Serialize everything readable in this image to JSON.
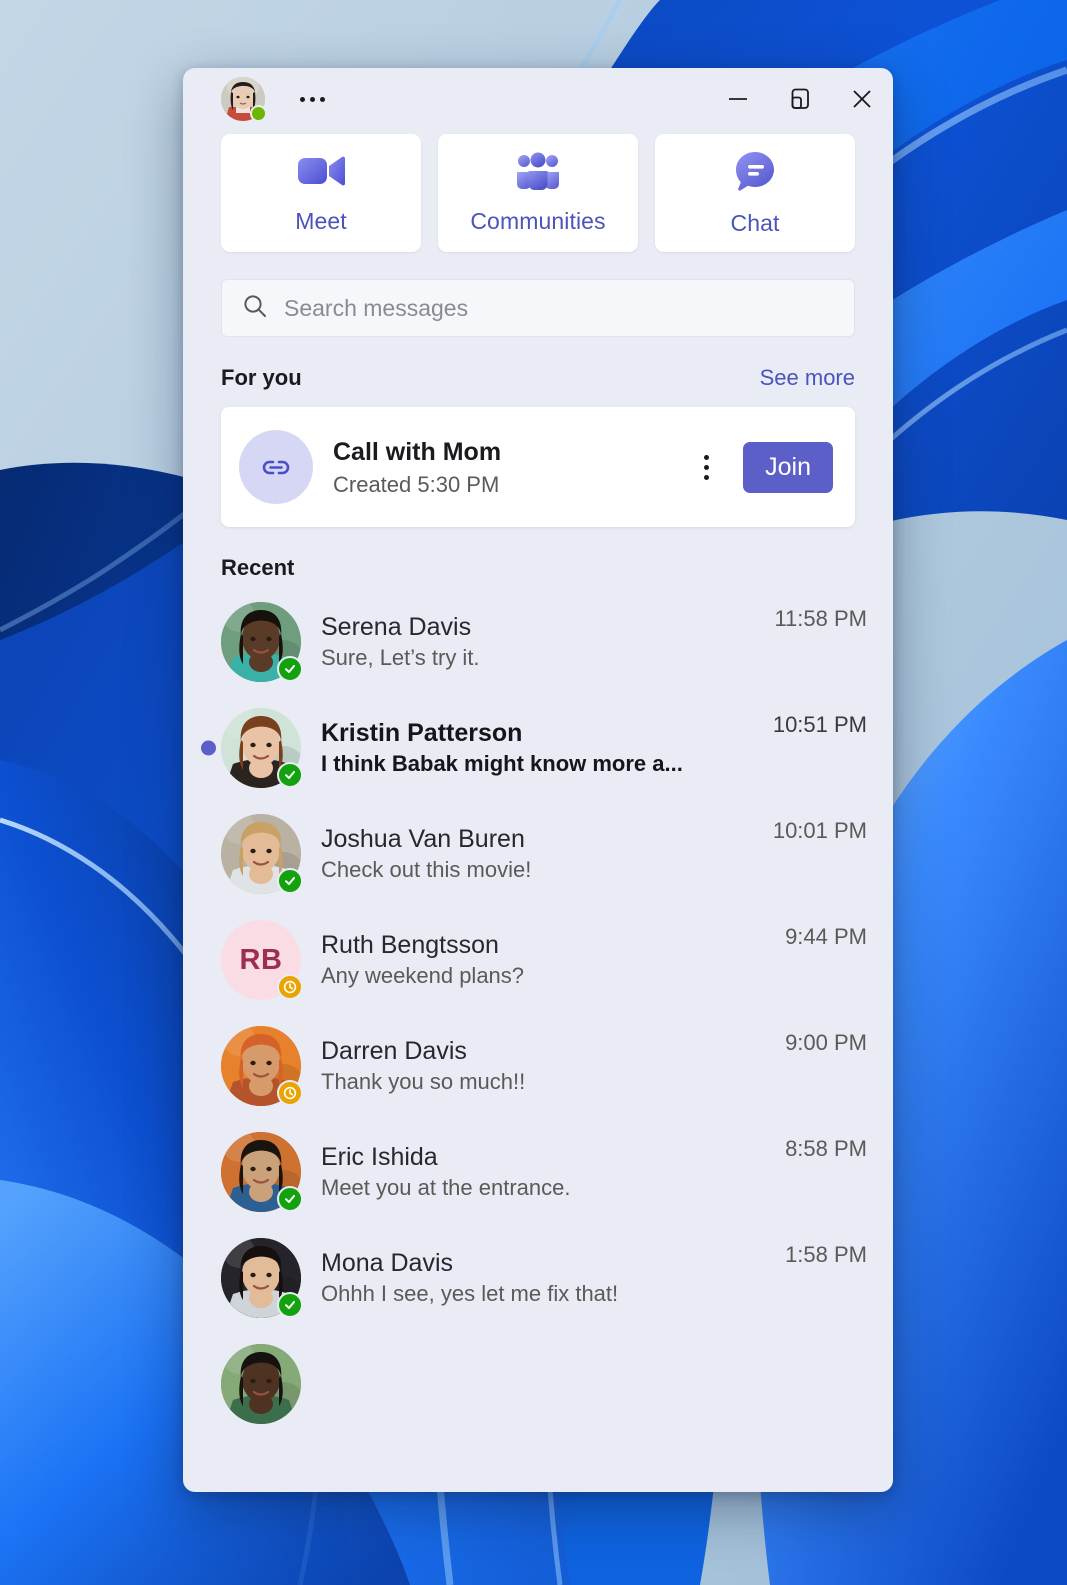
{
  "window": {
    "titlebar": {
      "avatar_name": "user-avatar",
      "presence": "available",
      "more_label": "More options",
      "minimize_label": "Minimize",
      "restore_label": "Restore",
      "close_label": "Close"
    },
    "nav": [
      {
        "label": "Meet",
        "icon": "video-camera-icon"
      },
      {
        "label": "Communities",
        "icon": "people-group-icon"
      },
      {
        "label": "Chat",
        "icon": "chat-bubble-icon"
      }
    ],
    "search": {
      "placeholder": "Search messages",
      "value": "",
      "icon": "search-icon"
    },
    "for_you": {
      "title": "For you",
      "see_more": "See more",
      "meeting": {
        "icon": "link-icon",
        "title": "Call with Mom",
        "subtitle": "Created 5:30 PM",
        "overflow": "More options",
        "join_label": "Join"
      }
    },
    "recent": {
      "title": "Recent",
      "chats": [
        {
          "name": "Serena Davis",
          "preview": "Sure, Let’s try it.",
          "time": "11:58 PM",
          "unread": false,
          "presence": "available",
          "avatar": "photo",
          "photo": "serena",
          "initials": "",
          "bg": "#7fae8c",
          "fg": "#ffffff"
        },
        {
          "name": "Kristin Patterson",
          "preview": "I think Babak might know more a...",
          "time": "10:51 PM",
          "unread": true,
          "presence": "available",
          "avatar": "photo",
          "photo": "kristin",
          "initials": "",
          "bg": "#cfe3d6",
          "fg": "#ffffff"
        },
        {
          "name": "Joshua Van Buren",
          "preview": "Check out this movie!",
          "time": "10:01 PM",
          "unread": false,
          "presence": "available",
          "avatar": "photo",
          "photo": "joshua",
          "initials": "",
          "bg": "#b7b1a4",
          "fg": "#ffffff"
        },
        {
          "name": "Ruth Bengtsson",
          "preview": "Any weekend plans?",
          "time": "9:44 PM",
          "unread": false,
          "presence": "away",
          "avatar": "initials",
          "photo": "",
          "initials": "RB",
          "bg": "#fadce4",
          "fg": "#9b2f52"
        },
        {
          "name": "Darren Davis",
          "preview": "Thank you so much!!",
          "time": "9:00 PM",
          "unread": false,
          "presence": "away",
          "avatar": "photo",
          "photo": "darren",
          "initials": "",
          "bg": "#e5782a",
          "fg": "#ffffff"
        },
        {
          "name": "Eric Ishida",
          "preview": "Meet you at the entrance.",
          "time": "8:58 PM",
          "unread": false,
          "presence": "available",
          "avatar": "photo",
          "photo": "eric",
          "initials": "",
          "bg": "#c96b2b",
          "fg": "#ffffff"
        },
        {
          "name": "Mona Davis",
          "preview": "Ohhh I see, yes let me fix that!",
          "time": "1:58 PM",
          "unread": false,
          "presence": "available",
          "avatar": "photo",
          "photo": "mona",
          "initials": "",
          "bg": "#2b2b30",
          "fg": "#ffffff"
        },
        {
          "name": "",
          "preview": "",
          "time": "",
          "unread": false,
          "presence": "none",
          "avatar": "photo",
          "photo": "partial",
          "initials": "",
          "bg": "#8fae7f",
          "fg": "#ffffff"
        }
      ]
    }
  },
  "colors": {
    "accent": "#5b5fc7",
    "window_bg": "#e9ebf5",
    "card_bg": "#ffffff",
    "available": "#13a10e",
    "away": "#eaa300",
    "link_text": "#4b53bc"
  },
  "desktop": {
    "wallpaper": "windows-11-bloom-blue"
  }
}
